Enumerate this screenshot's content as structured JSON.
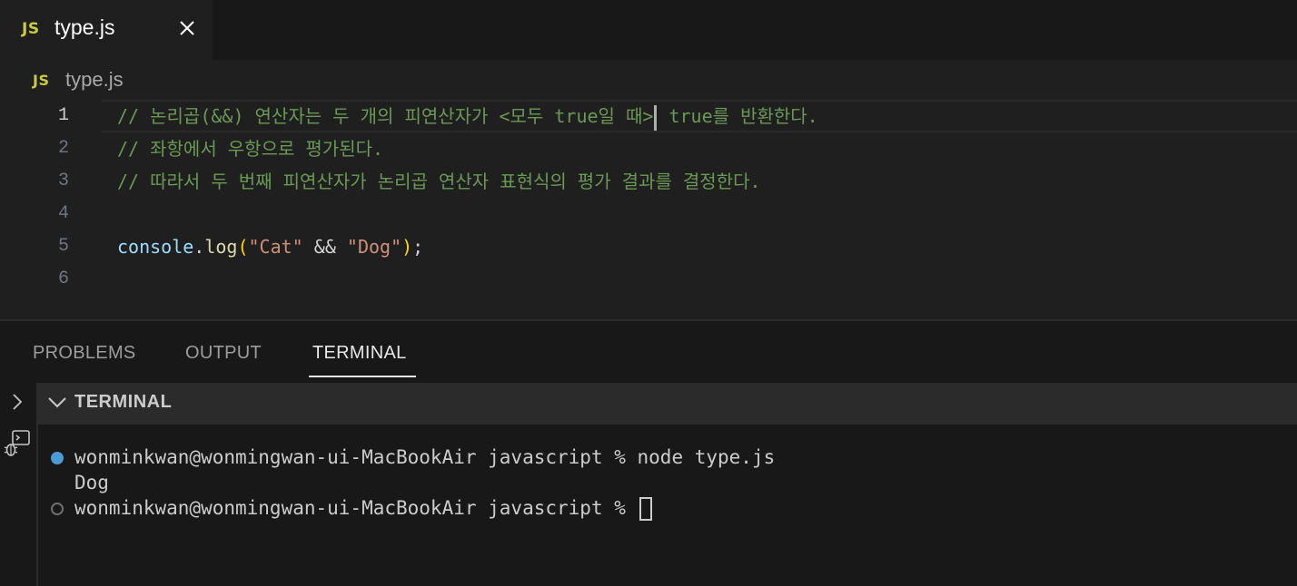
{
  "tab": {
    "lang_badge": "JS",
    "title": "type.js"
  },
  "breadcrumb": {
    "lang_badge": "JS",
    "label": "type.js"
  },
  "editor": {
    "line_numbers": [
      "1",
      "2",
      "3",
      "4",
      "5",
      "6"
    ],
    "comment1_a": "// 논리곱(&&) 연산자는 두 개의 피연산자가 <모두 true일 때>",
    "comment1_b": " true를 반환한다.",
    "comment2": "// 좌항에서 우항으로 평가된다.",
    "comment3": "// 따라서 두 번째 피연산자가 논리곱 연산자 표현식의 평가 결과를 결정한다.",
    "code5": {
      "object": "console",
      "dot": ".",
      "method": "log",
      "open_paren": "(",
      "str1": "\"Cat\"",
      "operator": " && ",
      "str2": "\"Dog\"",
      "close_paren": ")",
      "semicolon": ";"
    }
  },
  "panel": {
    "tabs": [
      "PROBLEMS",
      "OUTPUT",
      "TERMINAL"
    ],
    "active_tab": "TERMINAL",
    "terminal_header": "TERMINAL",
    "terminal_lines": {
      "cmd1": "wonminkwan@wonmingwan-ui-MacBookAir javascript % node type.js",
      "output": "Dog",
      "prompt": "wonminkwan@wonmingwan-ui-MacBookAir javascript % "
    }
  },
  "colors": {
    "editor_bg": "#1f1f1f",
    "panel_bg": "#181818",
    "comment": "#6a9955",
    "string": "#ce9178",
    "js_badge": "#cbcb41"
  }
}
